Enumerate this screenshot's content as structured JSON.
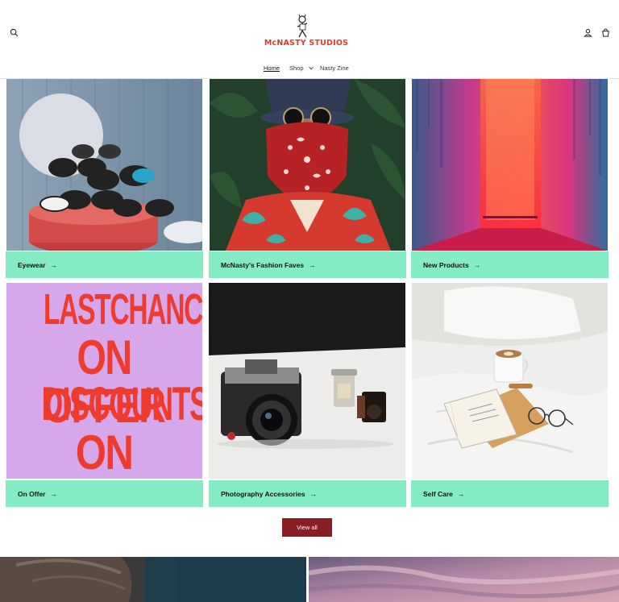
{
  "header": {
    "logo_text": "McNASTY STUDIOS",
    "icons": {
      "search": "search-icon",
      "account": "account-icon",
      "cart": "cart-icon"
    }
  },
  "nav": {
    "items": [
      {
        "label": "Home",
        "active": true
      },
      {
        "label": "Shop",
        "has_dropdown": true
      },
      {
        "label": "Nasty Zine"
      }
    ]
  },
  "collections": [
    {
      "label": "Eyewear"
    },
    {
      "label": "McNasty's Fashion Faves"
    },
    {
      "label": "New Products"
    },
    {
      "label": "On Offer"
    },
    {
      "label": "Photography Accessories"
    },
    {
      "label": "Self Care"
    }
  ],
  "promo_image_text": [
    "LASTCHANCE",
    "ON OFFER",
    "DISCOUNTS",
    "ON SALE"
  ],
  "view_all_label": "View all",
  "colors": {
    "card_bar": "#84ecc4",
    "button": "#8a1e22",
    "logo": "#e03a2f",
    "promo_bg": "#d7a7ec",
    "promo_text": "#ef3b2d"
  }
}
